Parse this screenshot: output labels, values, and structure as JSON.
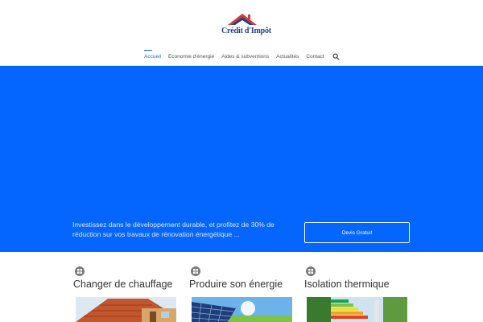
{
  "header": {
    "logo_text": "Crédit d'Impôt",
    "logo_colors": {
      "roof_red": "#e0352c",
      "roof_blue": "#1f3f8f"
    }
  },
  "nav": {
    "items": [
      {
        "label": "Accueil",
        "active": true
      },
      {
        "label": "Economie d'énergie",
        "active": false
      },
      {
        "label": "Aides & subventions",
        "active": false
      },
      {
        "label": "Actualités",
        "active": false
      },
      {
        "label": "Contact",
        "active": false
      }
    ],
    "search_icon": "search-icon"
  },
  "hero": {
    "background_color": "#0566ff",
    "text": "Investissez dans le développement durable, et profitez de 30% de réduction sur vos travaux de rénovation énergétique ...",
    "button_label": "Devis Gratuit"
  },
  "features": [
    {
      "title": "Changer de chauffage",
      "icon": "grid-icon",
      "image": "wooden-house-roof-image"
    },
    {
      "title": "Produire son énergie",
      "icon": "grid-icon",
      "image": "solar-panels-image"
    },
    {
      "title": "Isolation thermique",
      "icon": "grid-icon",
      "image": "energy-rating-image"
    }
  ]
}
